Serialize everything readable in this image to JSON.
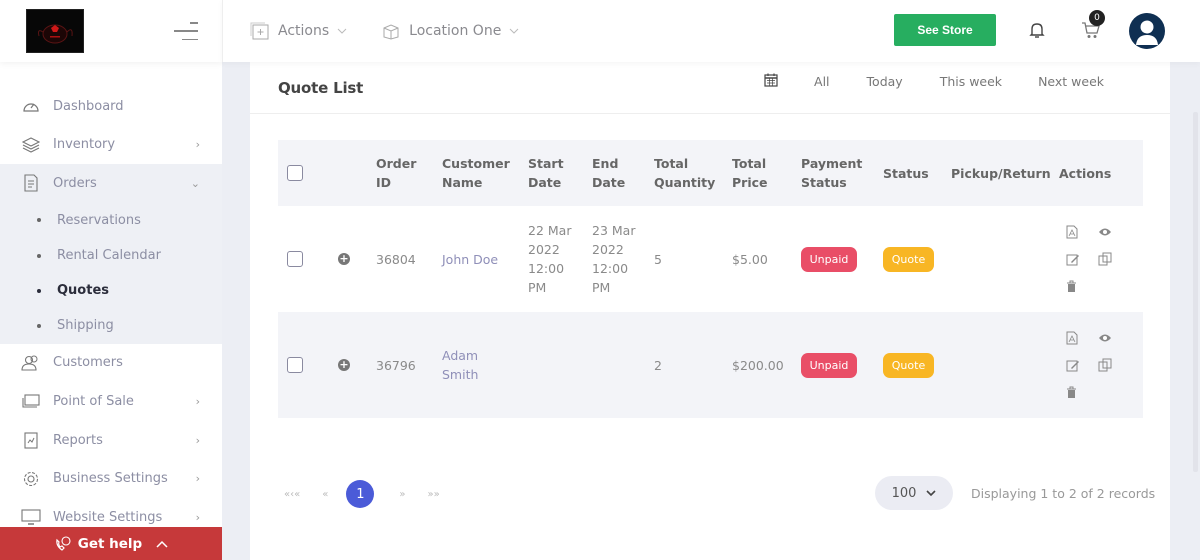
{
  "topbar": {
    "actions_label": "Actions",
    "location_label": "Location One",
    "see_store_label": "See Store",
    "cart_count": "0"
  },
  "sidebar": {
    "items": [
      {
        "label": "Dashboard",
        "icon": "dashboard-icon",
        "chevron": ""
      },
      {
        "label": "Inventory",
        "icon": "layers-icon",
        "chevron": "›"
      },
      {
        "label": "Orders",
        "icon": "document-icon",
        "chevron": "⌄"
      },
      {
        "label": "Customers",
        "icon": "users-icon",
        "chevron": ""
      },
      {
        "label": "Point of Sale",
        "icon": "pos-icon",
        "chevron": "›"
      },
      {
        "label": "Reports",
        "icon": "report-icon",
        "chevron": "›"
      },
      {
        "label": "Business Settings",
        "icon": "gear-icon",
        "chevron": "›"
      },
      {
        "label": "Website Settings",
        "icon": "monitor-icon",
        "chevron": "›"
      }
    ],
    "orders_sub": [
      {
        "label": "Reservations",
        "active": false
      },
      {
        "label": "Rental Calendar",
        "active": false
      },
      {
        "label": "Quotes",
        "active": true
      },
      {
        "label": "Shipping",
        "active": false
      }
    ],
    "get_help_label": "Get help",
    "get_help_caret": "^"
  },
  "card": {
    "title": "Quote List",
    "filters": [
      "All",
      "Today",
      "This week",
      "Next week"
    ]
  },
  "table": {
    "headers": {
      "order_id": [
        "Order",
        "ID"
      ],
      "customer": [
        "Customer",
        "Name"
      ],
      "start": [
        "Start",
        "Date"
      ],
      "end": [
        "End",
        "Date"
      ],
      "qty": [
        "Total",
        "Quantity"
      ],
      "price": [
        "Total",
        "Price"
      ],
      "payment": [
        "Payment",
        "Status"
      ],
      "status": "Status",
      "pickup": "Pickup/Return",
      "actions": "Actions"
    },
    "rows": [
      {
        "order_id": "36804",
        "customer": [
          "John Doe",
          ""
        ],
        "start": [
          "22 Mar",
          "2022",
          "12:00",
          "PM"
        ],
        "end": [
          "23 Mar",
          "2022",
          "12:00",
          "PM"
        ],
        "qty": "5",
        "price": "$5.00",
        "payment_status": "Unpaid",
        "status": "Quote",
        "pickup": ""
      },
      {
        "order_id": "36796",
        "customer": [
          "Adam",
          "Smith"
        ],
        "start": [
          "",
          "",
          "",
          ""
        ],
        "end": [
          "",
          "",
          "",
          ""
        ],
        "qty": "2",
        "price": "$200.00",
        "payment_status": "Unpaid",
        "status": "Quote",
        "pickup": ""
      }
    ]
  },
  "pagination": {
    "first": "«‹«",
    "prev": "«",
    "current": "1",
    "next": "»",
    "last": "»»",
    "per_page": "100",
    "records_text": "Displaying 1 to 2 of 2 records"
  },
  "colors": {
    "see_store": "#27ae60",
    "get_help": "#c6393a",
    "unpaid": "#e94e67",
    "quote": "#f8b624",
    "page_active": "#4b5bd8",
    "avatar": "#0f2f52"
  }
}
